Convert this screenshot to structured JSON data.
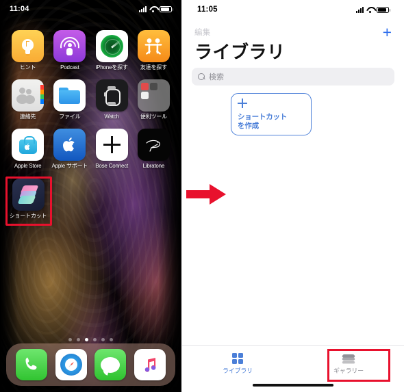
{
  "left_phone": {
    "status_bar": {
      "time": "11:04",
      "signal_icon": "cellular-bars-icon",
      "wifi_icon": "wifi-icon",
      "battery_icon": "battery-icon"
    },
    "app_rows": [
      [
        {
          "label": "ヒント",
          "icon": "tips-icon"
        },
        {
          "label": "Podcast",
          "icon": "podcast-icon"
        },
        {
          "label": "iPhoneを探す",
          "icon": "find-iphone-icon"
        },
        {
          "label": "友達を探す",
          "icon": "find-friends-icon"
        }
      ],
      [
        {
          "label": "連絡先",
          "icon": "contacts-icon"
        },
        {
          "label": "ファイル",
          "icon": "files-icon"
        },
        {
          "label": "Watch",
          "icon": "watch-icon"
        },
        {
          "label": "便利ツール",
          "icon": "folder-icon"
        }
      ],
      [
        {
          "label": "Apple Store",
          "icon": "apple-store-icon"
        },
        {
          "label": "Apple サポート",
          "icon": "apple-support-icon"
        },
        {
          "label": "Bose Connect",
          "icon": "bose-connect-icon"
        },
        {
          "label": "Libratone",
          "icon": "libratone-icon"
        }
      ],
      [
        {
          "label": "ショートカット",
          "icon": "shortcuts-icon"
        }
      ]
    ],
    "page_dots": {
      "count": 6,
      "active_index": 2
    },
    "dock": [
      {
        "label": "Phone",
        "icon": "phone-icon"
      },
      {
        "label": "Safari",
        "icon": "safari-icon"
      },
      {
        "label": "Messages",
        "icon": "messages-icon"
      },
      {
        "label": "Music",
        "icon": "music-icon"
      }
    ],
    "highlight": {
      "target": "ショートカット",
      "color": "#e8112d"
    }
  },
  "arrow": {
    "icon": "right-arrow-icon",
    "color": "#e8112d"
  },
  "right_phone": {
    "status_bar": {
      "time": "11:05",
      "signal_icon": "cellular-bars-icon",
      "wifi_icon": "wifi-icon",
      "battery_icon": "battery-icon"
    },
    "nav": {
      "edit_label": "編集",
      "edit_color": "#c9c9cf",
      "add_label": "+",
      "add_color": "#2f6fed"
    },
    "title": "ライブラリ",
    "search": {
      "placeholder": "検索",
      "icon": "search-icon"
    },
    "create_card": {
      "plus_icon": "plus-icon",
      "line1": "ショートカット",
      "line2": "を作成",
      "border_color": "#4b7fd8"
    },
    "tab_bar": {
      "tabs": [
        {
          "label": "ライブラリ",
          "icon": "grid-icon",
          "state": "active",
          "color": "#4b7fd8"
        },
        {
          "label": "ギャラリー",
          "icon": "layers-icon",
          "state": "inactive",
          "color": "#8b8b92"
        }
      ]
    },
    "highlight": {
      "target": "ギャラリー",
      "color": "#e8112d"
    }
  }
}
